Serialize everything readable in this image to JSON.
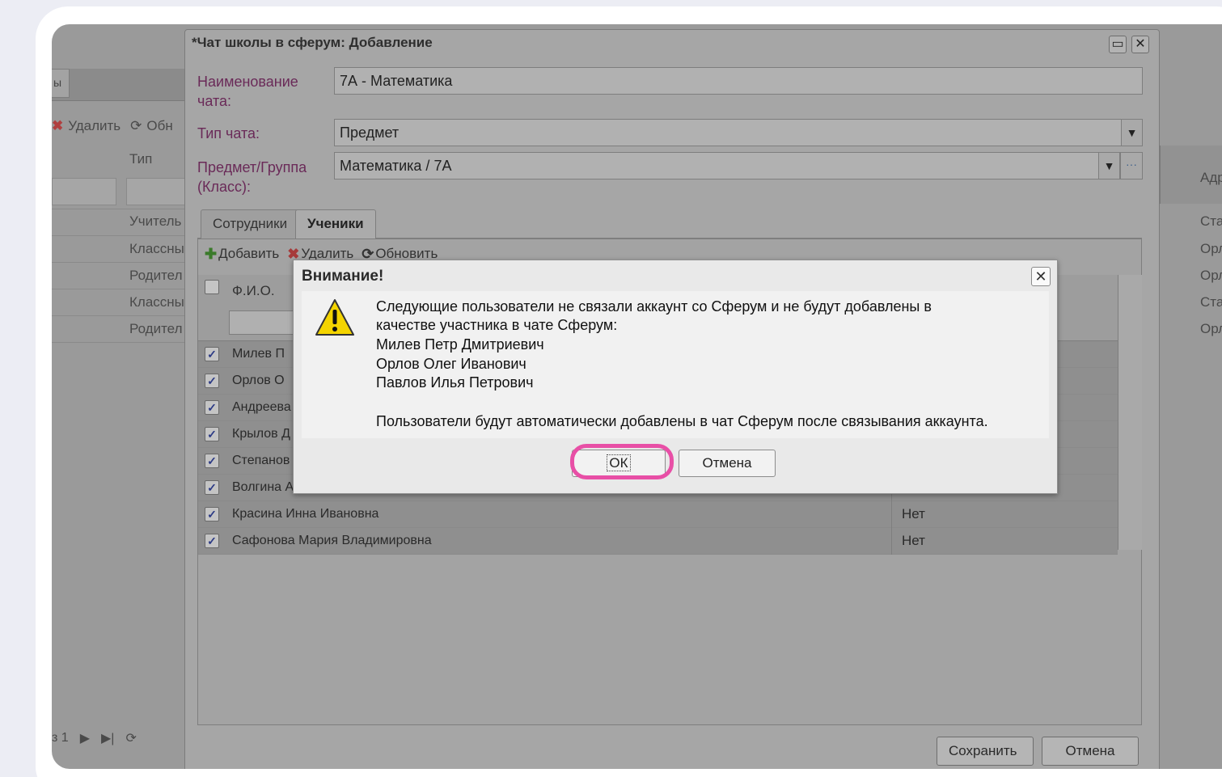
{
  "background_window": {
    "tab_label": "ы",
    "toolbar": {
      "delete_label": "Удалить",
      "refresh_label": "Обн"
    },
    "column_type": "Тип",
    "rows": [
      "Учитель",
      "Классны",
      "Родител",
      "Классны",
      "Родител"
    ],
    "right_col_header": "Адр",
    "right_col": [
      "Ста",
      "Орл",
      "Орл",
      "Ста",
      "Орл"
    ],
    "pager_text": "з 1"
  },
  "chat_window": {
    "title": "*Чат школы в сферум: Добавление",
    "fields": {
      "name_label_line1": "Наименование",
      "name_label_line2": "чата:",
      "name_value": "7А - Математика",
      "type_label": "Тип чата:",
      "type_value": "Предмет",
      "subject_label_line1": "Предмет/Группа",
      "subject_label_line2": "(Класс):",
      "subject_value": "Математика / 7А"
    },
    "tabs": {
      "employees": "Сотрудники",
      "students": "Ученики"
    },
    "toolbar": {
      "add": "Добавить",
      "delete": "Удалить",
      "refresh": "Обновить"
    },
    "grid": {
      "col_fio": "Ф.И.О.",
      "rows": [
        {
          "name": "Милев П",
          "value": ""
        },
        {
          "name": "Орлов О",
          "value": ""
        },
        {
          "name": "Андреева",
          "value": ""
        },
        {
          "name": "Крылов Д",
          "value": ""
        },
        {
          "name": "Степанов",
          "value": ""
        },
        {
          "name": "Волгина А",
          "value": ""
        },
        {
          "name": "Красина Инна Ивановна",
          "value": "Нет"
        },
        {
          "name": "Сафонова Мария Владимировна",
          "value": "Нет"
        }
      ]
    },
    "save_label": "Сохранить",
    "cancel_label": "Отмена"
  },
  "alert": {
    "title": "Внимание!",
    "lines": [
      "Следующие пользователи не связали аккаунт со Сферум и не будут добавлены в",
      "качестве участника в чате Сферум:",
      "Милев Петр Дмитриевич",
      "Орлов Олег Иванович",
      "Павлов Илья Петрович"
    ],
    "footer_line": "Пользователи будут автоматически добавлены в чат Сферум после связывания аккаунта.",
    "ok_label": "ОК",
    "cancel_label": "Отмена",
    "highlight_color": "#e84fa6"
  },
  "icons": [
    "warning-icon",
    "close-icon",
    "maximize-icon",
    "add-icon",
    "delete-icon",
    "refresh-icon",
    "dropdown-arrow-icon",
    "ellipsis-icon",
    "checkbox-icon"
  ]
}
